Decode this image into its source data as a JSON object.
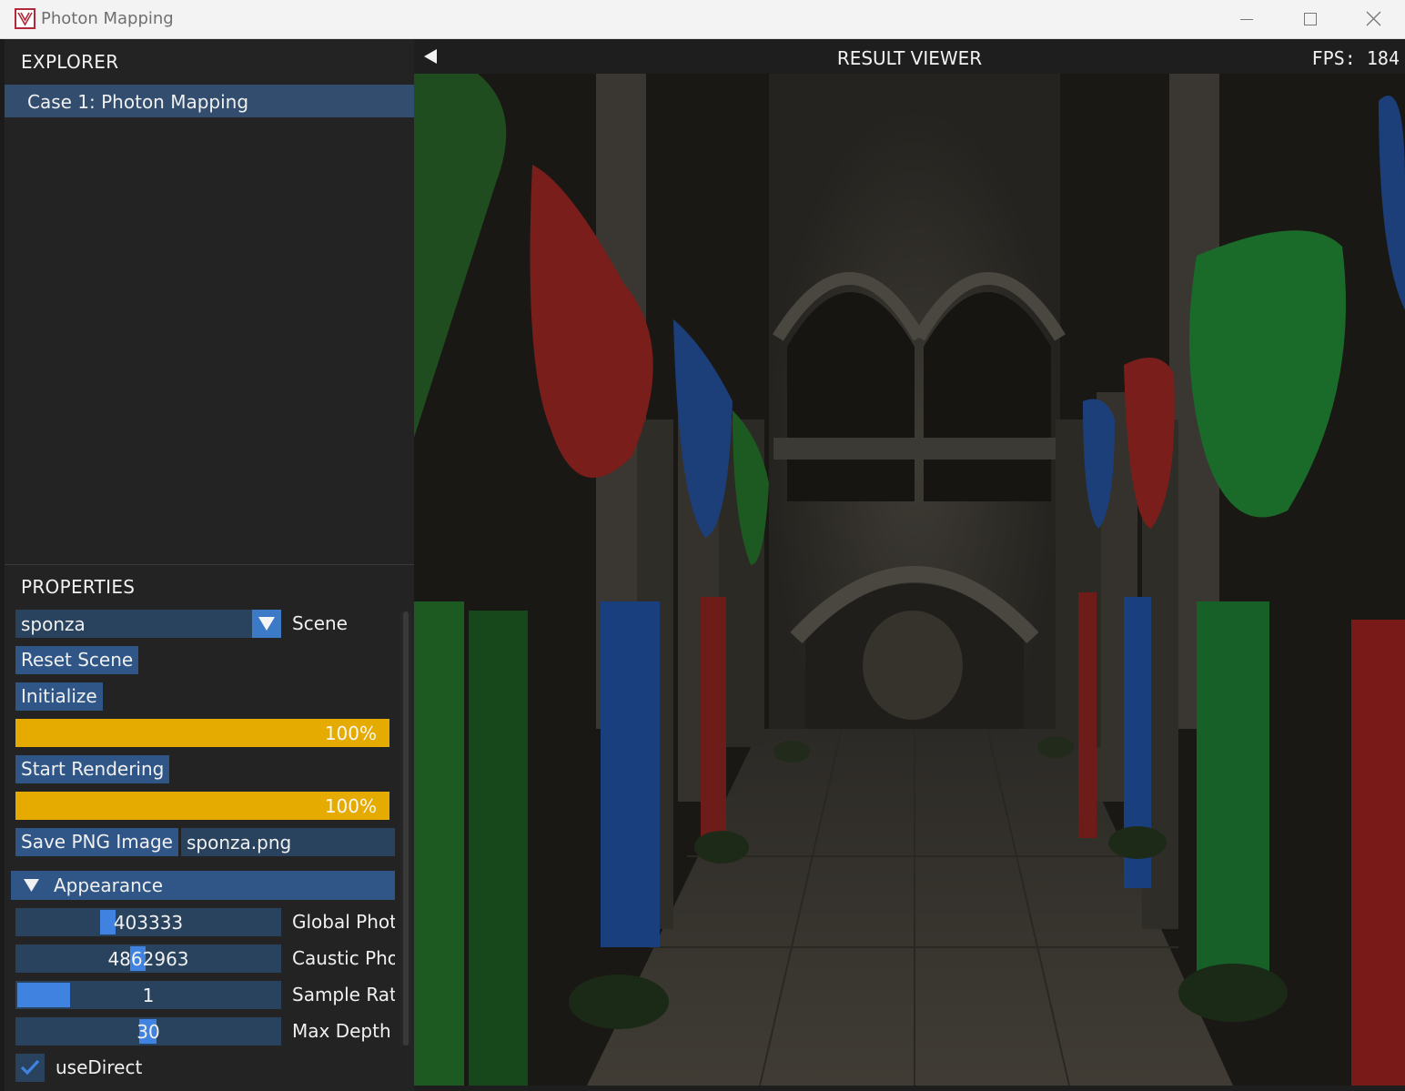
{
  "window": {
    "title": "Photon Mapping"
  },
  "explorer": {
    "header": "EXPLORER",
    "items": [
      {
        "label": "Case 1: Photon Mapping",
        "selected": true
      }
    ]
  },
  "properties": {
    "header": "PROPERTIES",
    "scene": {
      "value": "sponza",
      "label": "Scene"
    },
    "reset_button": "Reset Scene",
    "initialize_button": "Initialize",
    "init_progress": {
      "text": "100%",
      "fraction": 1.0
    },
    "start_button": "Start Rendering",
    "render_progress": {
      "text": "100%",
      "fraction": 1.0
    },
    "save_button": "Save PNG Image",
    "filename": "sponza.png",
    "appearance": {
      "header": "Appearance",
      "expanded": true,
      "sliders": [
        {
          "value": "403333",
          "label": "Global Phot"
        },
        {
          "value": "4862963",
          "label": "Caustic Pho"
        },
        {
          "value": "1",
          "label": "Sample Ratе"
        },
        {
          "value": "30",
          "label": "Max Depth"
        }
      ],
      "use_direct": {
        "label": "useDirect",
        "checked": true
      }
    }
  },
  "viewer": {
    "title": "RESULT VIEWER",
    "fps_label": "FPS:",
    "fps_value": "184",
    "image": "rendered-sponza-atrium"
  },
  "colors": {
    "accent": "#3f82e0",
    "progress": "#e6ab00",
    "button": "#2f5687",
    "selection": "#324d6e"
  }
}
